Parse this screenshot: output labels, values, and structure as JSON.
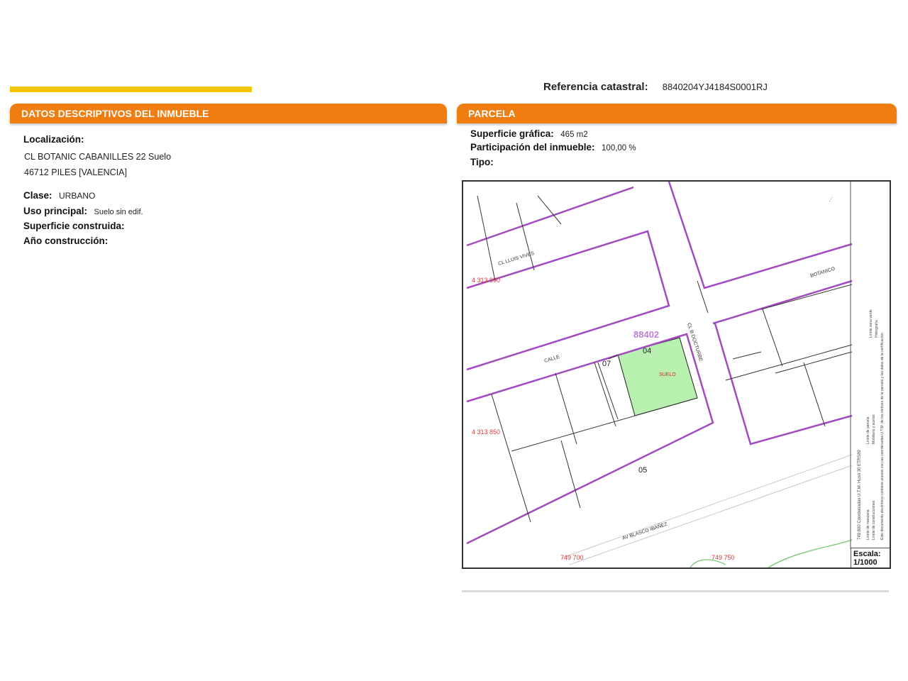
{
  "header": {
    "ref_label": "Referencia catastral:",
    "ref_value": "8840204YJ4184S0001RJ"
  },
  "left_section": {
    "title_normal": "DATOS DESCRIPTIVOS DEL ",
    "title_highlight": "INMUEBLE",
    "localizacion_label": "Localización:",
    "address_line1": "CL BOTANIC CABANILLES 22 Suelo",
    "address_line2": "46712 PILES [VALENCIA]",
    "clase_label": "Clase:",
    "clase_value": "URBANO",
    "uso_label": "Uso principal:",
    "uso_value": "Suelo sin edif.",
    "superficie_label": "Superficie construida:",
    "ano_label": "Año construcción:"
  },
  "right_section": {
    "title": "PARCELA",
    "superficie_label": "Superficie gráfica:",
    "superficie_value": "465 m2",
    "participacion_label": "Participación del inmueble:",
    "participacion_value": "100,00 %",
    "tipo_label": "Tipo:"
  },
  "map": {
    "parcel_code": "88402",
    "parcel_04": "04",
    "parcel_07": "07",
    "parcel_05": "05",
    "suelo_label": "SUELO",
    "street_lluis_vives": "CL LLUIS VIVES",
    "street_calle": "CALLE",
    "street_blasco": "AV BLASCO IBAÑEZ",
    "street_botanico": "BOTANICO",
    "street_doctor": "CL B DOCTURBE",
    "coord_y1": "4 313 900",
    "coord_y2": "4 313 850",
    "coord_x1": "749 700",
    "coord_x2": "749 750",
    "escala_label": "Escala:",
    "escala_value": "1/1000",
    "highlight_color": "#b8f0b0",
    "boundary_color": "#a24bc0",
    "coord_color": "#d23b3b",
    "legend_items": [
      "Límite de manzana",
      "Límite de parcela",
      "Límite de construcciones",
      "Mobiliario y aceras",
      "Límite zona verde",
      "Hidrografía"
    ],
    "legend_note": "Este documento electrónico contiene anexos con las coordenadas U.T.M. de los vértices de la parcela y los datos de la certificación.",
    "legend_coords": "749.800 Coordenadas U.T.M. Huso 30 ETRS89"
  }
}
